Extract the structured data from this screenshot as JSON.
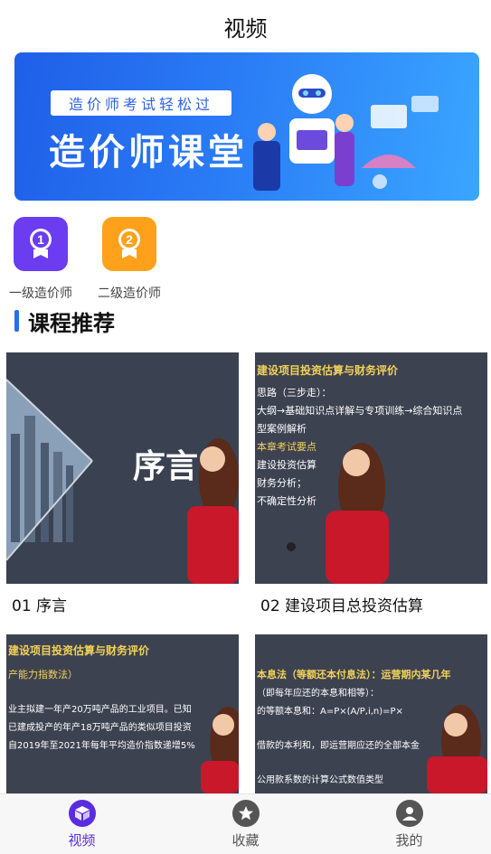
{
  "header": {
    "title": "视频"
  },
  "banner": {
    "label": "造价师考试轻松过",
    "title": "造价师课堂"
  },
  "categories": [
    {
      "label": "一级造价师",
      "badge": "1",
      "color": "#6b3cf0"
    },
    {
      "label": "二级造价师",
      "badge": "2",
      "color": "#ffa11a"
    }
  ],
  "section": {
    "title": "课程推荐"
  },
  "courses": [
    {
      "name": "01 序言",
      "thumb_text": "序言"
    },
    {
      "name": "02 建设项目总投资估算",
      "thumb_heading": "建设项目投资估算与财务评价",
      "thumb_lines": [
        "思路（三步走）：",
        "大纲→基础知识点详解与专项训练→综合知识点",
        "型案例解析",
        "本章考试要点",
        "建设投资估算",
        "财务分析；",
        "不确定性分析"
      ]
    },
    {
      "name": "",
      "thumb_heading": "建设项目投资估算与财务评价",
      "thumb_lines": [
        "产能力指数法）",
        "业主拟建一年产20万吨产品的工业项目。已知",
        "已建成投产的年产18万吨产品的类似项目投资",
        "自2019年至2021年每年平均造价指数递增5%"
      ]
    },
    {
      "name": "",
      "thumb_heading": "本息法（等额还本付息法）：运营期内某几年",
      "thumb_lines": [
        "（即每年应还的本息和相等）：",
        "的等额本息和：A=P×(A/P,i,n)=P×",
        "借款的本利和，即运营期应还的全部本金",
        "公用款系数的计算公式数值类型"
      ]
    }
  ],
  "tabbar": [
    {
      "label": "视频",
      "active": true
    },
    {
      "label": "收藏",
      "active": false
    },
    {
      "label": "我的",
      "active": false
    }
  ]
}
